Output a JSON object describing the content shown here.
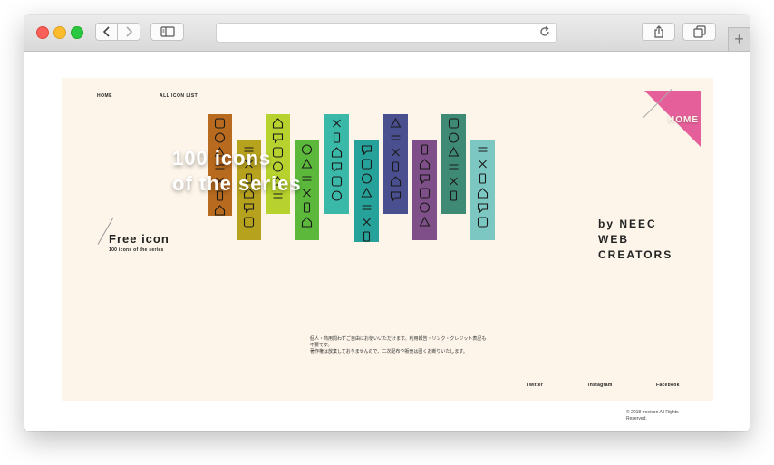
{
  "browser": {
    "url": "",
    "icons": {
      "back": "chevron-left-icon",
      "forward": "chevron-right-icon",
      "sidebar": "sidebar-icon",
      "reload": "reload-icon",
      "share": "share-icon",
      "tabs": "tabs-icon",
      "new_tab": "plus-icon"
    },
    "new_tab_label": "+"
  },
  "nav": {
    "home": "HOME",
    "all_icon_list": "ALL ICON LIST"
  },
  "corner": {
    "label": "HOME",
    "color": "#e5609a"
  },
  "hero": {
    "title_line1": "100 icons",
    "title_line2": "of the series",
    "free_icon": "Free icon",
    "free_sub": "100 icons of the series",
    "byline_1": "by NEEC",
    "byline_2": "WEB",
    "byline_3": "CREATORS"
  },
  "strip_colors": [
    "#b86a1e",
    "#b7a21e",
    "#b7d12e",
    "#5bb83a",
    "#3ab8a8",
    "#26a29a",
    "#4a4f8f",
    "#7e4f88",
    "#3f8a74",
    "#7cc7c2"
  ],
  "description": {
    "line1": "個人・商用問わずご自由にお使いいただけます。利用報告・リンク・クレジット表記も",
    "line2": "不要です。",
    "line3": "著作権は放棄しておりませんので、二次配布や販売は固くお断りいたします。"
  },
  "footer": {
    "twitter": "Twitter",
    "instagram": "Instagram",
    "facebook": "Facebook",
    "copyright_1": "© 2018 freeicon All Rights",
    "copyright_2": "Reserved."
  },
  "colors": {
    "page_background": "#fdf5ea",
    "accent_pink": "#e5609a"
  }
}
